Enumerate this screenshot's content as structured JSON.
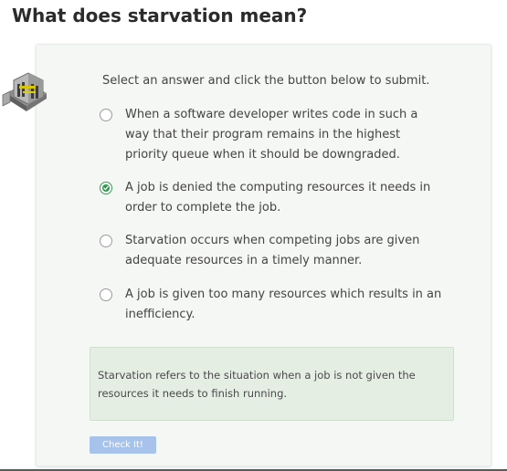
{
  "question": {
    "title": "What does starvation mean?"
  },
  "activity": {
    "icon": "activity-machine-icon",
    "instructions": "Select an answer and click the button below to submit."
  },
  "options": [
    {
      "text": "When a software developer writes code in such a way that their program remains in the highest priority queue when it should be downgraded.",
      "selected": false
    },
    {
      "text": "A job is denied the computing resources it needs in order to complete the job.",
      "selected": true
    },
    {
      "text": "Starvation occurs when competing jobs are given adequate resources in a timely manner.",
      "selected": false
    },
    {
      "text": "A job is given too many resources which results in an inefficiency.",
      "selected": false
    }
  ],
  "feedback": {
    "text": "Starvation refers to the situation when a job is not given the resources it needs to finish running."
  },
  "submit": {
    "label": "Check It!"
  },
  "colors": {
    "card_background": "#f4f7f4",
    "feedback_background": "#e4eee3",
    "selected_green": "#2f9a4f",
    "button_background": "#a7c3ec"
  }
}
